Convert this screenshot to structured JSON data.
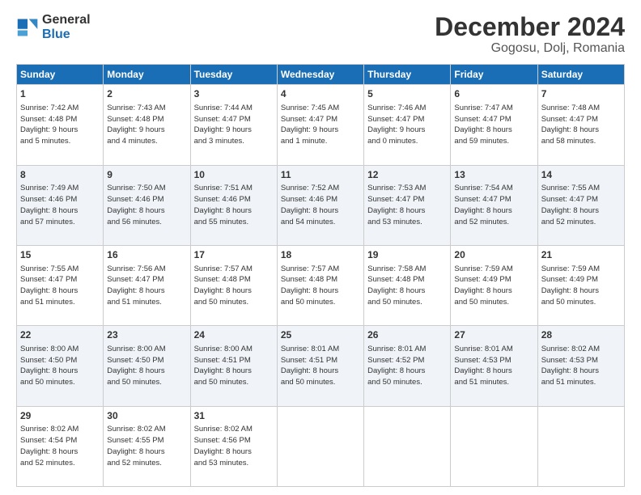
{
  "header": {
    "logo_line1": "General",
    "logo_line2": "Blue",
    "title": "December 2024",
    "subtitle": "Gogosu, Dolj, Romania"
  },
  "calendar": {
    "days_of_week": [
      "Sunday",
      "Monday",
      "Tuesday",
      "Wednesday",
      "Thursday",
      "Friday",
      "Saturday"
    ],
    "weeks": [
      [
        {
          "day": "1",
          "info": "Sunrise: 7:42 AM\nSunset: 4:48 PM\nDaylight: 9 hours\nand 5 minutes."
        },
        {
          "day": "2",
          "info": "Sunrise: 7:43 AM\nSunset: 4:48 PM\nDaylight: 9 hours\nand 4 minutes."
        },
        {
          "day": "3",
          "info": "Sunrise: 7:44 AM\nSunset: 4:47 PM\nDaylight: 9 hours\nand 3 minutes."
        },
        {
          "day": "4",
          "info": "Sunrise: 7:45 AM\nSunset: 4:47 PM\nDaylight: 9 hours\nand 1 minute."
        },
        {
          "day": "5",
          "info": "Sunrise: 7:46 AM\nSunset: 4:47 PM\nDaylight: 9 hours\nand 0 minutes."
        },
        {
          "day": "6",
          "info": "Sunrise: 7:47 AM\nSunset: 4:47 PM\nDaylight: 8 hours\nand 59 minutes."
        },
        {
          "day": "7",
          "info": "Sunrise: 7:48 AM\nSunset: 4:47 PM\nDaylight: 8 hours\nand 58 minutes."
        }
      ],
      [
        {
          "day": "8",
          "info": "Sunrise: 7:49 AM\nSunset: 4:46 PM\nDaylight: 8 hours\nand 57 minutes."
        },
        {
          "day": "9",
          "info": "Sunrise: 7:50 AM\nSunset: 4:46 PM\nDaylight: 8 hours\nand 56 minutes."
        },
        {
          "day": "10",
          "info": "Sunrise: 7:51 AM\nSunset: 4:46 PM\nDaylight: 8 hours\nand 55 minutes."
        },
        {
          "day": "11",
          "info": "Sunrise: 7:52 AM\nSunset: 4:46 PM\nDaylight: 8 hours\nand 54 minutes."
        },
        {
          "day": "12",
          "info": "Sunrise: 7:53 AM\nSunset: 4:47 PM\nDaylight: 8 hours\nand 53 minutes."
        },
        {
          "day": "13",
          "info": "Sunrise: 7:54 AM\nSunset: 4:47 PM\nDaylight: 8 hours\nand 52 minutes."
        },
        {
          "day": "14",
          "info": "Sunrise: 7:55 AM\nSunset: 4:47 PM\nDaylight: 8 hours\nand 52 minutes."
        }
      ],
      [
        {
          "day": "15",
          "info": "Sunrise: 7:55 AM\nSunset: 4:47 PM\nDaylight: 8 hours\nand 51 minutes."
        },
        {
          "day": "16",
          "info": "Sunrise: 7:56 AM\nSunset: 4:47 PM\nDaylight: 8 hours\nand 51 minutes."
        },
        {
          "day": "17",
          "info": "Sunrise: 7:57 AM\nSunset: 4:48 PM\nDaylight: 8 hours\nand 50 minutes."
        },
        {
          "day": "18",
          "info": "Sunrise: 7:57 AM\nSunset: 4:48 PM\nDaylight: 8 hours\nand 50 minutes."
        },
        {
          "day": "19",
          "info": "Sunrise: 7:58 AM\nSunset: 4:48 PM\nDaylight: 8 hours\nand 50 minutes."
        },
        {
          "day": "20",
          "info": "Sunrise: 7:59 AM\nSunset: 4:49 PM\nDaylight: 8 hours\nand 50 minutes."
        },
        {
          "day": "21",
          "info": "Sunrise: 7:59 AM\nSunset: 4:49 PM\nDaylight: 8 hours\nand 50 minutes."
        }
      ],
      [
        {
          "day": "22",
          "info": "Sunrise: 8:00 AM\nSunset: 4:50 PM\nDaylight: 8 hours\nand 50 minutes."
        },
        {
          "day": "23",
          "info": "Sunrise: 8:00 AM\nSunset: 4:50 PM\nDaylight: 8 hours\nand 50 minutes."
        },
        {
          "day": "24",
          "info": "Sunrise: 8:00 AM\nSunset: 4:51 PM\nDaylight: 8 hours\nand 50 minutes."
        },
        {
          "day": "25",
          "info": "Sunrise: 8:01 AM\nSunset: 4:51 PM\nDaylight: 8 hours\nand 50 minutes."
        },
        {
          "day": "26",
          "info": "Sunrise: 8:01 AM\nSunset: 4:52 PM\nDaylight: 8 hours\nand 50 minutes."
        },
        {
          "day": "27",
          "info": "Sunrise: 8:01 AM\nSunset: 4:53 PM\nDaylight: 8 hours\nand 51 minutes."
        },
        {
          "day": "28",
          "info": "Sunrise: 8:02 AM\nSunset: 4:53 PM\nDaylight: 8 hours\nand 51 minutes."
        }
      ],
      [
        {
          "day": "29",
          "info": "Sunrise: 8:02 AM\nSunset: 4:54 PM\nDaylight: 8 hours\nand 52 minutes."
        },
        {
          "day": "30",
          "info": "Sunrise: 8:02 AM\nSunset: 4:55 PM\nDaylight: 8 hours\nand 52 minutes."
        },
        {
          "day": "31",
          "info": "Sunrise: 8:02 AM\nSunset: 4:56 PM\nDaylight: 8 hours\nand 53 minutes."
        },
        null,
        null,
        null,
        null
      ]
    ]
  }
}
